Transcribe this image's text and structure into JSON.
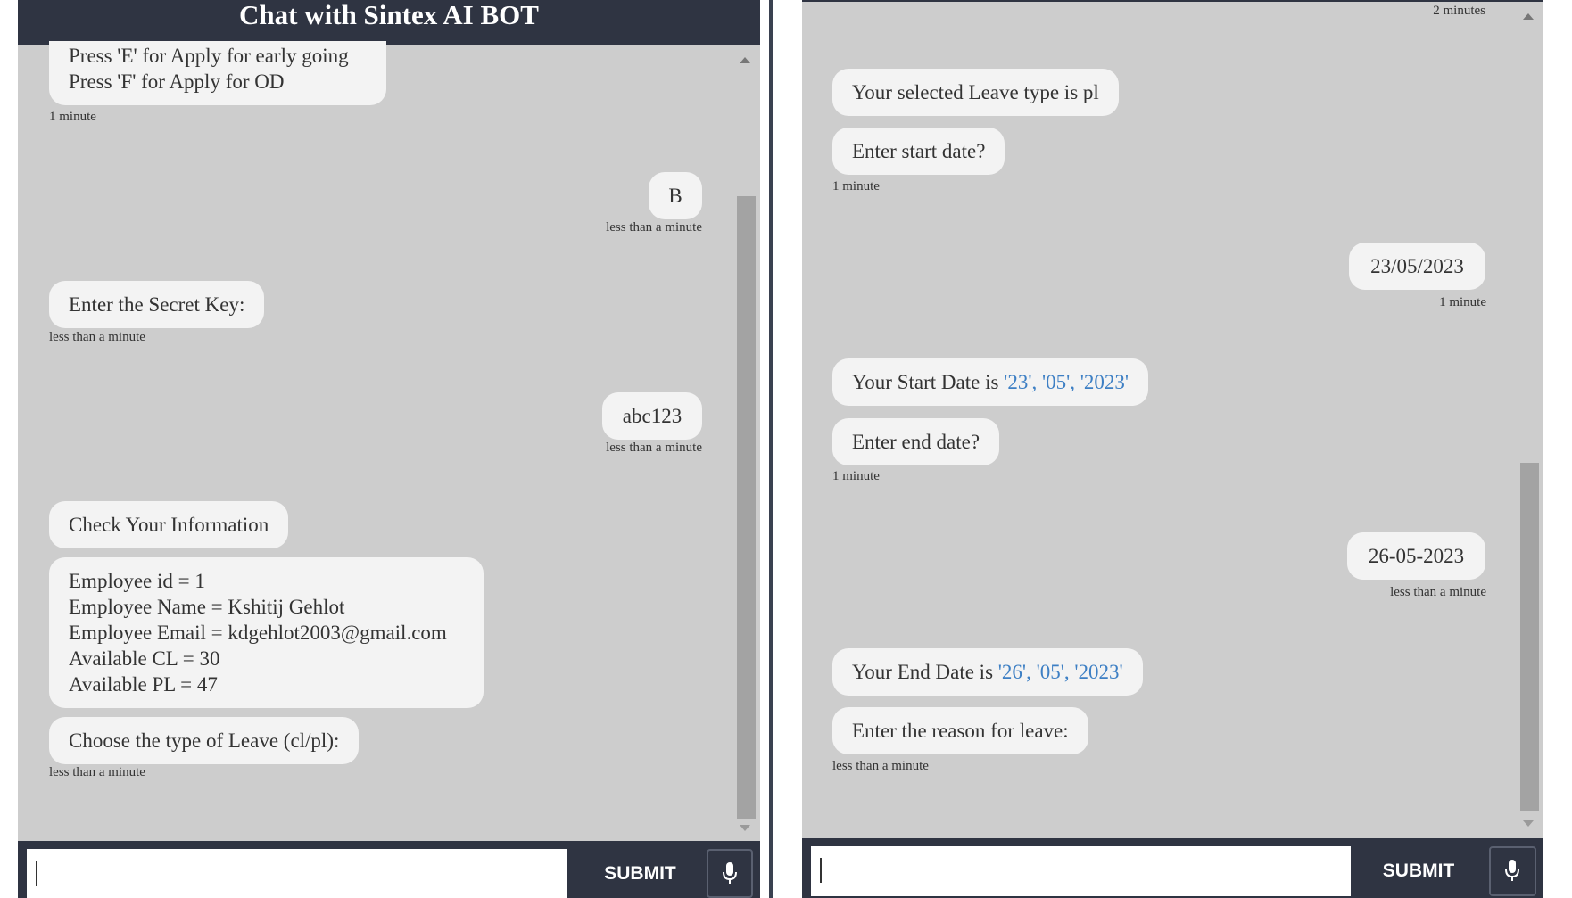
{
  "left": {
    "title": "Chat with Sintex AI BOT",
    "messages": [
      {
        "lines": [
          "Press 'E' for Apply for early going",
          "Press 'F' for Apply for OD"
        ],
        "time": "1 minute"
      },
      {
        "text": "B",
        "time": "less than a minute"
      },
      {
        "text": "Enter the Secret Key:",
        "time": "less than a minute"
      },
      {
        "text": "abc123",
        "time": "less than a minute"
      },
      {
        "text": "Check Your Information"
      },
      {
        "lines": [
          "Employee id = 1",
          "Employee Name = Kshitij Gehlot",
          "Employee Email = kdgehlot2003@gmail.com",
          "Available CL = 30",
          "Available PL = 47"
        ]
      },
      {
        "text": "Choose the type of Leave (cl/pl):",
        "time": "less than a minute"
      }
    ],
    "input_value": "",
    "submit_label": "SUBMIT"
  },
  "right": {
    "top_time": "2 minutes",
    "messages": [
      {
        "text": "Your selected Leave type is pl"
      },
      {
        "text": "Enter start date?",
        "time": "1 minute"
      },
      {
        "text": "23/05/2023",
        "time": "1 minute"
      },
      {
        "prefix": "Your Start Date is ",
        "value": "'23', '05', '2023'"
      },
      {
        "text": "Enter end date?",
        "time": "1 minute"
      },
      {
        "text": "26-05-2023",
        "time": "less than a minute"
      },
      {
        "prefix": "Your End Date is ",
        "value": "'26', '05', '2023'"
      },
      {
        "text": "Enter the reason for leave:",
        "time": "less than a minute"
      }
    ],
    "input_value": "",
    "submit_label": "SUBMIT"
  },
  "icons": {
    "microphone": "microphone-icon",
    "scroll_up": "scroll-up-arrow-icon",
    "scroll_down": "scroll-down-arrow-icon"
  },
  "colors": {
    "header": "#2f3442",
    "background": "#cdcdcd",
    "bubble": "#f3f3f3",
    "link": "#3d7fc4"
  }
}
